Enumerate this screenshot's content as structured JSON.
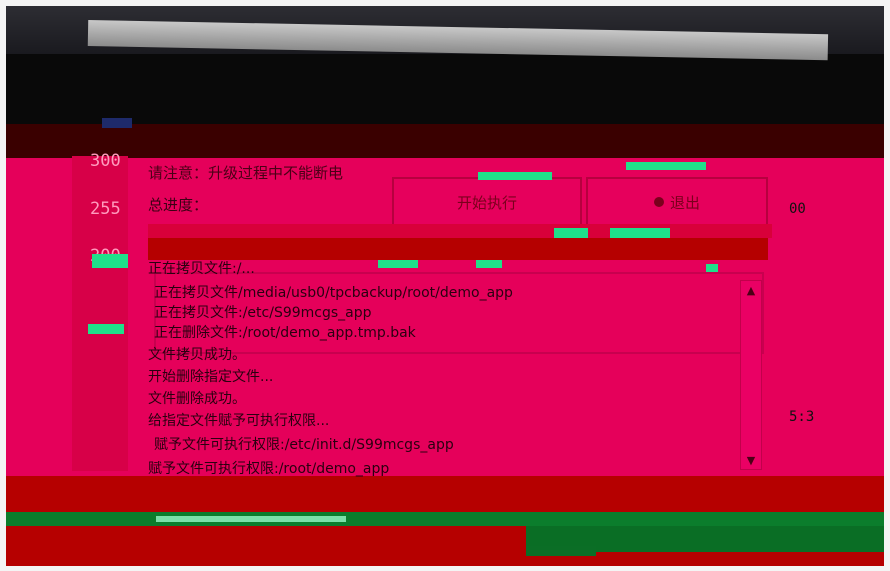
{
  "left_gauge": {
    "values": [
      "300",
      "255",
      "200"
    ]
  },
  "right_gauge": {
    "values": [
      "00",
      "5:3"
    ]
  },
  "dialog": {
    "warning_text": "请注意：升级过程中不能断电",
    "progress_label": "总进度：",
    "progress_fraction": 0.95,
    "buttons": {
      "left_label": "开始执行",
      "right_label": "退出"
    }
  },
  "log": {
    "lines": [
      "正在拷贝文件:/...",
      "正在拷贝文件/media/usb0/tpcbackup/root/demo_app",
      "正在拷贝文件:/etc/S99mcgs_app",
      "正在删除文件:/root/demo_app.tmp.bak",
      "文件拷贝成功。",
      "开始删除指定文件...",
      "文件删除成功。",
      "给指定文件赋予可执行权限...",
      "赋予文件可执行权限:/etc/init.d/S99mcgs_app",
      "赋予文件可执行权限:/root/demo_app"
    ]
  },
  "scrollbar": {
    "up_icon": "arrow-up-icon",
    "down_icon": "arrow-down-icon"
  }
}
